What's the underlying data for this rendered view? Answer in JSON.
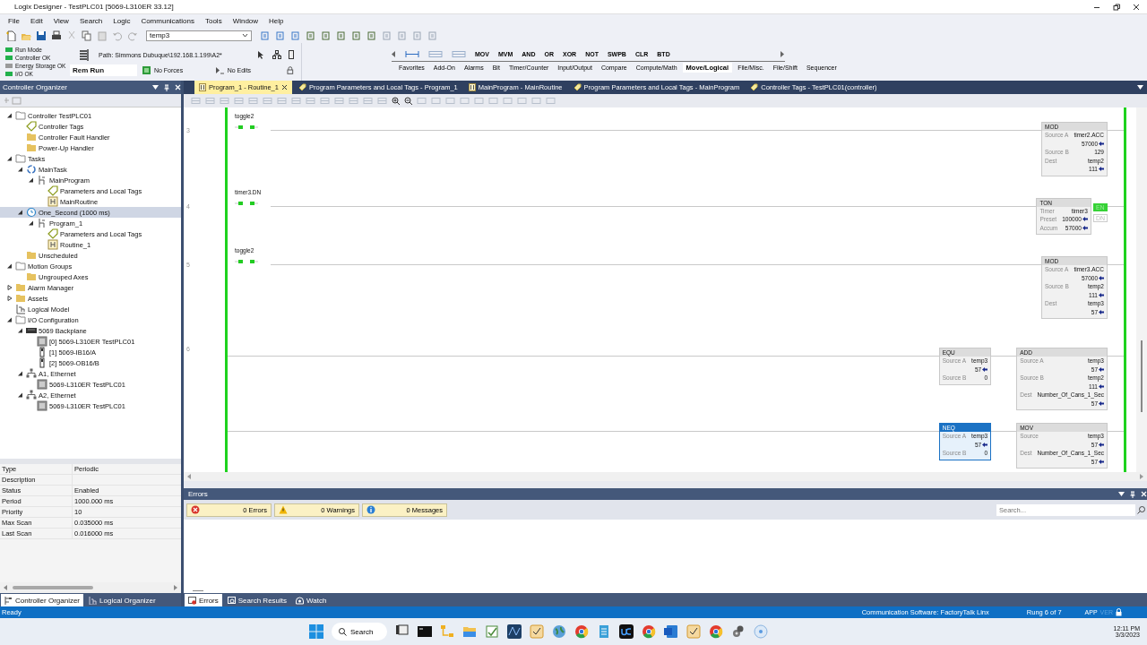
{
  "window": {
    "title": "Logix Designer - TestPLC01 [5069-L310ER 33.12]"
  },
  "menu": [
    "File",
    "Edit",
    "View",
    "Search",
    "Logic",
    "Communications",
    "Tools",
    "Window",
    "Help"
  ],
  "toolbar": {
    "tag_search": "temp3"
  },
  "controller_status": {
    "lights": [
      {
        "label": "Run Mode",
        "color": "#22b14c"
      },
      {
        "label": "Controller OK",
        "color": "#22b14c"
      },
      {
        "label": "Energy Storage OK",
        "color": "#9a9a9a"
      },
      {
        "label": "I/O OK",
        "color": "#22b14c"
      }
    ],
    "mode": "Rem Run",
    "path": "Path: Simmons Dubuque\\192.168.1.199\\A2*",
    "forces": "No Forces",
    "edits": "No Edits"
  },
  "instruction_palette": {
    "instructions": [
      "MOV",
      "MVM",
      "AND",
      "OR",
      "XOR",
      "NOT",
      "SWPB",
      "CLR",
      "BTD"
    ],
    "tabs": [
      {
        "label": "Favorites",
        "selected": false
      },
      {
        "label": "Add-On",
        "selected": false
      },
      {
        "label": "Alarms",
        "selected": false
      },
      {
        "label": "Bit",
        "selected": false
      },
      {
        "label": "Timer/Counter",
        "selected": false
      },
      {
        "label": "Input/Output",
        "selected": false
      },
      {
        "label": "Compare",
        "selected": false
      },
      {
        "label": "Compute/Math",
        "selected": false
      },
      {
        "label": "Move/Logical",
        "selected": true
      },
      {
        "label": "File/Misc.",
        "selected": false
      },
      {
        "label": "File/Shift",
        "selected": false
      },
      {
        "label": "Sequencer",
        "selected": false
      }
    ]
  },
  "organizer": {
    "title": "Controller Organizer",
    "tree": [
      {
        "label": "Controller TestPLC01",
        "kind": "controller",
        "expanded": true,
        "selected": false,
        "children": [
          {
            "label": "Controller Tags",
            "kind": "tag",
            "selected": false
          },
          {
            "label": "Controller Fault Handler",
            "kind": "folder",
            "selected": false
          },
          {
            "label": "Power-Up Handler",
            "kind": "folder",
            "selected": false
          }
        ]
      },
      {
        "label": "Tasks",
        "kind": "controller",
        "expanded": true,
        "selected": false,
        "children": [
          {
            "label": "MainTask",
            "kind": "task",
            "expanded": true,
            "selected": false,
            "children": [
              {
                "label": "MainProgram",
                "kind": "program",
                "expanded": true,
                "selected": false,
                "children": [
                  {
                    "label": "Parameters and Local Tags",
                    "kind": "tag",
                    "selected": false
                  },
                  {
                    "label": "MainRoutine",
                    "kind": "routine",
                    "selected": false
                  }
                ]
              }
            ]
          },
          {
            "label": "One_Second (1000 ms)",
            "kind": "periodic",
            "expanded": true,
            "selected": true,
            "children": [
              {
                "label": "Program_1",
                "kind": "program",
                "expanded": true,
                "selected": false,
                "children": [
                  {
                    "label": "Parameters and Local Tags",
                    "kind": "tag",
                    "selected": false
                  },
                  {
                    "label": "Routine_1",
                    "kind": "routine",
                    "selected": false
                  }
                ]
              }
            ]
          },
          {
            "label": "Unscheduled",
            "kind": "folder",
            "selected": false
          }
        ]
      },
      {
        "label": "Motion Groups",
        "kind": "controller",
        "expanded": true,
        "selected": false,
        "children": [
          {
            "label": "Ungrouped Axes",
            "kind": "folder",
            "selected": false
          }
        ]
      },
      {
        "label": "Alarm Manager",
        "kind": "folder",
        "expanded": false,
        "selected": false
      },
      {
        "label": "Assets",
        "kind": "folder",
        "expanded": false,
        "selected": false
      },
      {
        "label": "Logical Model",
        "kind": "model",
        "selected": false
      },
      {
        "label": "I/O Configuration",
        "kind": "controller",
        "expanded": true,
        "selected": false,
        "children": [
          {
            "label": "5069 Backplane",
            "kind": "backplane",
            "expanded": true,
            "selected": false,
            "children": [
              {
                "label": "[0] 5069-L310ER TestPLC01",
                "kind": "module",
                "selected": false
              },
              {
                "label": "[1] 5069-IB16/A",
                "kind": "card",
                "selected": false
              },
              {
                "label": "[2] 5069-OB16/B",
                "kind": "card",
                "selected": false
              }
            ]
          },
          {
            "label": "A1, Ethernet",
            "kind": "network",
            "expanded": true,
            "selected": false,
            "children": [
              {
                "label": "5069-L310ER TestPLC01",
                "kind": "module",
                "selected": false
              }
            ]
          },
          {
            "label": "A2, Ethernet",
            "kind": "network",
            "expanded": true,
            "selected": false,
            "children": [
              {
                "label": "5069-L310ER TestPLC01",
                "kind": "module",
                "selected": false
              }
            ]
          }
        ]
      }
    ],
    "properties": [
      {
        "name": "Type",
        "value": "Periodic"
      },
      {
        "name": "Description"
      },
      {
        "name": "Status",
        "value": "Enabled"
      },
      {
        "name": "Period",
        "value": "1000.000 ms"
      },
      {
        "name": "Priority",
        "value": "10"
      },
      {
        "name": "Max Scan",
        "value": "0.035000 ms"
      },
      {
        "name": "Last Scan",
        "value": "0.016000 ms"
      }
    ],
    "tabs": [
      {
        "label": "Controller Organizer",
        "selected": true
      },
      {
        "label": "Logical Organizer",
        "selected": false
      }
    ]
  },
  "document_tabs": [
    {
      "label": "Program_1 - Routine_1",
      "kind": "routine",
      "selected": true
    },
    {
      "label": "Program Parameters and Local Tags - Program_1",
      "kind": "tag",
      "selected": false
    },
    {
      "label": "MainProgram - MainRoutine",
      "kind": "routine",
      "selected": false
    },
    {
      "label": "Program Parameters and Local Tags - MainProgram",
      "kind": "tag",
      "selected": false
    },
    {
      "label": "Controller Tags - TestPLC01(controller)",
      "kind": "tag",
      "selected": false
    }
  ],
  "ladder": {
    "rungs": [
      {
        "number": "3",
        "contacts": [
          {
            "tag": "toggle2",
            "energized": true
          }
        ],
        "blocks": [
          {
            "name": "MOD",
            "selected": false,
            "params": [
              {
                "label": "Source A",
                "tag": "timer2.ACC",
                "value": "57000"
              },
              {
                "label": "Source B",
                "tag": "129"
              },
              {
                "label": "Dest",
                "tag": "temp2",
                "value": "111"
              }
            ]
          }
        ]
      },
      {
        "number": "4",
        "contacts": [
          {
            "tag": "timer3.DN",
            "energized": true
          }
        ],
        "blocks": [
          {
            "name": "TON",
            "selected": false,
            "params": [
              {
                "label": "Timer",
                "tag": "timer3"
              },
              {
                "label": "Preset",
                "value": "100000"
              },
              {
                "label": "Accum",
                "value": "57000"
              }
            ],
            "outputs": [
              {
                "label": "EN",
                "on": true
              },
              {
                "label": "DN",
                "on": false
              }
            ]
          }
        ]
      },
      {
        "number": "5",
        "contacts": [
          {
            "tag": "toggle2",
            "energized": true
          }
        ],
        "blocks": [
          {
            "name": "MOD",
            "selected": false,
            "params": [
              {
                "label": "Source A",
                "tag": "timer3.ACC",
                "value": "57000"
              },
              {
                "label": "Source B",
                "tag": "temp2",
                "value": "111"
              },
              {
                "label": "Dest",
                "tag": "temp3",
                "value": "57"
              }
            ]
          }
        ]
      },
      {
        "number": "6",
        "branches": [
          {
            "blocks": [
              {
                "name": "EQU",
                "selected": false,
                "params": [
                  {
                    "label": "Source A",
                    "tag": "temp3",
                    "value": "57"
                  },
                  {
                    "label": "Source B",
                    "tag": "0"
                  }
                ]
              },
              {
                "name": "ADD",
                "selected": false,
                "params": [
                  {
                    "label": "Source A",
                    "tag": "temp3",
                    "value": "57"
                  },
                  {
                    "label": "Source B",
                    "tag": "temp2",
                    "value": "111"
                  },
                  {
                    "label": "Dest",
                    "tag": "Number_Of_Cans_1_Sec",
                    "value": "57"
                  }
                ]
              }
            ]
          },
          {
            "blocks": [
              {
                "name": "NEQ",
                "selected": true,
                "params": [
                  {
                    "label": "Source A",
                    "tag": "temp3",
                    "value": "57"
                  },
                  {
                    "label": "Source B",
                    "tag": "0"
                  }
                ]
              },
              {
                "name": "MOV",
                "selected": false,
                "params": [
                  {
                    "label": "Source",
                    "tag": "temp3",
                    "value": "57"
                  },
                  {
                    "label": "Dest",
                    "tag": "Number_Of_Cans_1_Sec",
                    "value": "57"
                  }
                ]
              }
            ]
          }
        ]
      }
    ]
  },
  "errors_panel": {
    "title": "Errors",
    "filters": [
      {
        "kind": "error",
        "label": "0 Errors"
      },
      {
        "kind": "warning",
        "label": "0 Warnings"
      },
      {
        "kind": "info",
        "label": "0 Messages"
      }
    ],
    "search": {
      "placeholder": "Search..."
    },
    "tabs": [
      {
        "label": "Errors",
        "selected": true
      },
      {
        "label": "Search Results",
        "selected": false
      },
      {
        "label": "Watch",
        "selected": false
      }
    ]
  },
  "status_bar": {
    "status": "Ready",
    "communication": "Communication Software: FactoryTalk Linx",
    "rung": "Rung 6 of 7",
    "app": "APP",
    "ver": "VER"
  },
  "taskbar": {
    "search": "Search",
    "time": "12:11 PM",
    "date": "3/3/2023"
  }
}
